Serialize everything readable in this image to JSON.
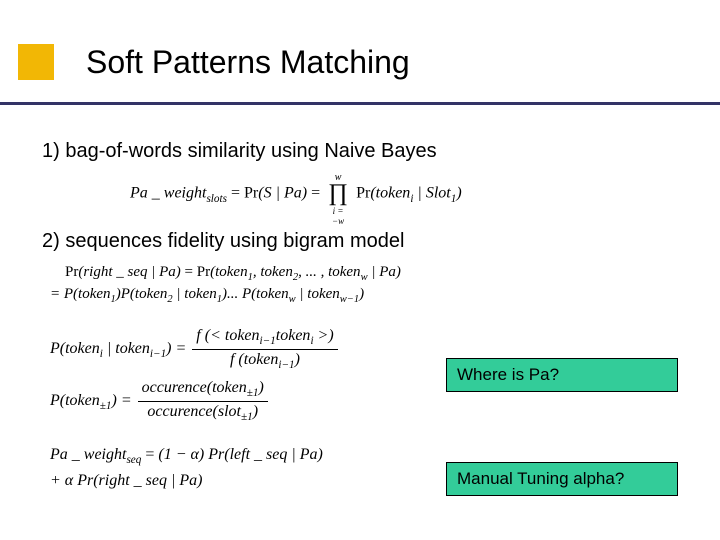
{
  "title": "Soft Patterns Matching",
  "items": {
    "one": "1)  bag-of-words similarity using Naive Bayes",
    "two": "2)  sequences fidelity using bigram model"
  },
  "eq": {
    "pa_weight_slots_lhs": "Pa _ weight",
    "slots_sub": "slots",
    "pr": "Pr",
    "S_given_Pa": "(S | Pa)",
    "prod_top": "w",
    "prod_bot": "i = −w",
    "token_i_given_slot": "(token",
    "i_sub": "i",
    "slot": " | Slot",
    "one_sub": "1",
    "close": ")",
    "right_seq_Pa": "(right _ seq | Pa)",
    "tokens_list": "(token",
    "comma": ",",
    "dots": ", ... ,",
    "w_sub": "w",
    "given_Pa": " | Pa)",
    "eq2b_lead": "= P(token",
    "P_cond_open": ")P(token",
    "given_token": " | token",
    "wm1_sub": "w−1",
    "eq3_lhs": "P(token",
    "im1_sub": "i−1",
    "f_open": "f (< token",
    "f_close": " >)",
    "f_single": "f (token",
    "eq4_lhs": "P(token",
    "pm1_sub": "±1",
    "occ_tok": "occurence(token",
    "occ_slot": "occurence(slot",
    "eq5_lhs": "Pa _ weight",
    "seq_sub": "seq",
    "one_minus_a": "(1 − α) Pr(left _ seq | Pa)",
    "plus_a": "+ α Pr(right _ seq | Pa)"
  },
  "callouts": {
    "c1": "Where is Pa?",
    "c2": "Manual Tuning alpha?"
  }
}
